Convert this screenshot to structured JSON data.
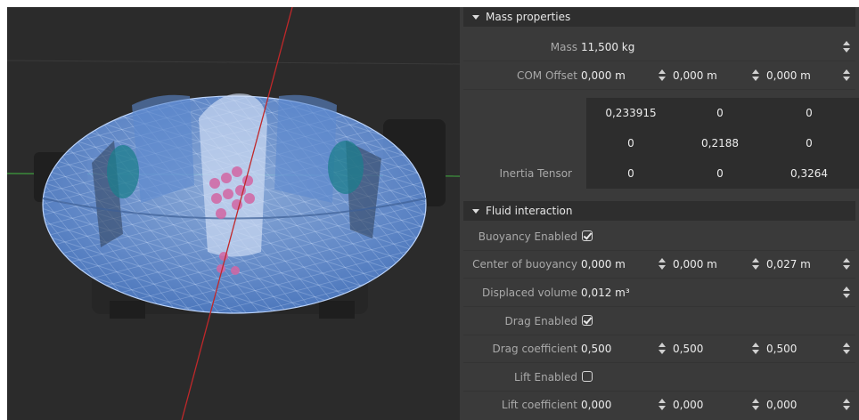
{
  "mass_properties": {
    "header": "Mass properties",
    "mass_label": "Mass",
    "mass_value": "11,500 kg",
    "com_label": "COM Offset",
    "com_x": "0,000 m",
    "com_y": "0,000 m",
    "com_z": "0,000 m",
    "inertia_label": "Inertia Tensor",
    "inertia_tensor": [
      [
        "0,233915",
        "0",
        "0"
      ],
      [
        "0",
        "0,2188",
        "0"
      ],
      [
        "0",
        "0",
        "0,3264"
      ]
    ]
  },
  "fluid_interaction": {
    "header": "Fluid interaction",
    "buoyancy_enabled_label": "Buoyancy Enabled",
    "buoyancy_enabled": true,
    "center_of_buoyancy_label": "Center of buoyancy",
    "cob_x": "0,000 m",
    "cob_y": "0,000 m",
    "cob_z": "0,027 m",
    "displaced_volume_label": "Displaced volume",
    "displaced_volume_value": "0,012 m³",
    "drag_enabled_label": "Drag Enabled",
    "drag_enabled": true,
    "drag_coefficient_label": "Drag coefficient",
    "drag_x": "0,500",
    "drag_y": "0,500",
    "drag_z": "0,500",
    "lift_enabled_label": "Lift Enabled",
    "lift_enabled": false,
    "lift_coefficient_label": "Lift coefficient",
    "lift_x": "0,000",
    "lift_y": "0,000",
    "lift_z": "0,000"
  },
  "icons": {
    "collapse": "triangle-down-icon",
    "spinner": "spinner-arrows-icon",
    "checkbox": "checkbox-icon"
  },
  "colors": {
    "viewport_bg": "#2b2b2b",
    "panel_bg": "#3a3a3a",
    "header_bg": "#2e2e2e",
    "collider_blue": "#6f9ee8",
    "axis_red": "#c0282a",
    "axis_green": "#3fa03f"
  }
}
